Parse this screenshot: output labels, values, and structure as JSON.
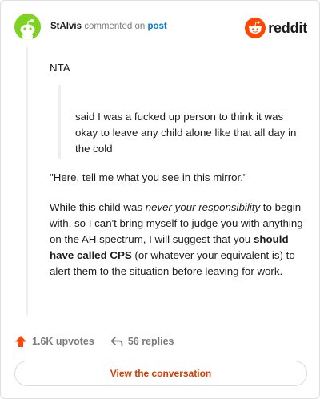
{
  "header": {
    "username": "StAlvis",
    "action_text": "commented on",
    "post_link": "post",
    "brand": "reddit",
    "colors": {
      "avatar": "#7ed321",
      "brand_orange": "#ff4500",
      "link_blue": "#0079d3"
    }
  },
  "comment": {
    "p1": "NTA",
    "quote": "said I was a fucked up person to think it was okay to leave any child alone like that all day in the cold",
    "p2": "\"Here, tell me what you see in this mirror.\"",
    "p3": {
      "a": "While this child was ",
      "italic": "never your responsibility",
      "b": " to begin with, so I can't bring myself to judge you with anything on the AH spectrum, I will suggest that you ",
      "bold": "should have called CPS",
      "c": " (or whatever your equivalent is) to alert them to the situation before leaving for work."
    }
  },
  "footer": {
    "upvotes": "1.6K upvotes",
    "replies": "56 replies",
    "upvote_icon": "upvote-arrow-icon",
    "reply_icon": "reply-arrow-icon"
  },
  "cta": {
    "label": "View the conversation"
  }
}
